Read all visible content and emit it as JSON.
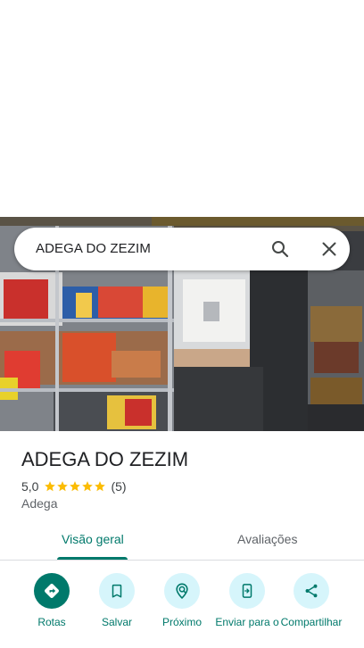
{
  "search": {
    "query": "ADEGA DO ZEZIM"
  },
  "place": {
    "title": "ADEGA DO ZEZIM",
    "rating": "5,0",
    "stars": 5,
    "review_count": "(5)",
    "category": "Adega"
  },
  "tabs": [
    {
      "label": "Visão geral",
      "selected": true
    },
    {
      "label": "Avaliações",
      "selected": false
    }
  ],
  "actions": [
    {
      "label": "Rotas",
      "icon": "directions-icon"
    },
    {
      "label": "Salvar",
      "icon": "bookmark-icon"
    },
    {
      "label": "Próximo",
      "icon": "nearby-icon"
    },
    {
      "label": "Enviar para o",
      "icon": "send-to-phone-icon"
    },
    {
      "label": "Compartilhar",
      "icon": "share-icon"
    }
  ],
  "colors": {
    "accent": "#00796b",
    "action_bg": "#d6f5fb",
    "star": "#fbbc04"
  }
}
